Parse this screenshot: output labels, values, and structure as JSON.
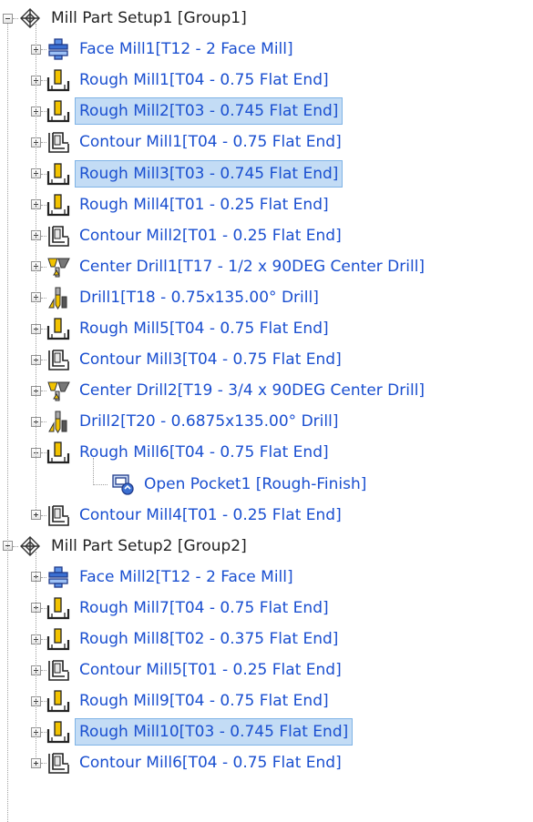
{
  "tree": {
    "groups": [
      {
        "label": "Mill Part Setup1 [Group1]",
        "icon": "mill-setup-icon",
        "expanded": true,
        "children": [
          {
            "label": "Face Mill1[T12 - 2 Face Mill]",
            "icon": "face-mill-icon",
            "selected": false
          },
          {
            "label": "Rough Mill1[T04 - 0.75 Flat End]",
            "icon": "rough-mill-icon",
            "selected": false
          },
          {
            "label": "Rough Mill2[T03 - 0.745 Flat End]",
            "icon": "rough-mill-icon",
            "selected": true
          },
          {
            "label": "Contour Mill1[T04 - 0.75 Flat End]",
            "icon": "contour-mill-icon",
            "selected": false
          },
          {
            "label": "Rough Mill3[T03 - 0.745 Flat End]",
            "icon": "rough-mill-icon",
            "selected": true
          },
          {
            "label": "Rough Mill4[T01 - 0.25 Flat End]",
            "icon": "rough-mill-icon",
            "selected": false
          },
          {
            "label": "Contour Mill2[T01 - 0.25 Flat End]",
            "icon": "contour-mill-icon",
            "selected": false
          },
          {
            "label": "Center Drill1[T17 - 1/2 x 90DEG Center Drill]",
            "icon": "center-drill-icon",
            "selected": false
          },
          {
            "label": "Drill1[T18 - 0.75x135.00° Drill]",
            "icon": "drill-icon",
            "selected": false
          },
          {
            "label": "Rough Mill5[T04 - 0.75 Flat End]",
            "icon": "rough-mill-icon",
            "selected": false
          },
          {
            "label": "Contour Mill3[T04 - 0.75 Flat End]",
            "icon": "contour-mill-icon",
            "selected": false
          },
          {
            "label": "Center Drill2[T19 - 3/4 x 90DEG Center Drill]",
            "icon": "center-drill-icon",
            "selected": false
          },
          {
            "label": "Drill2[T20 - 0.6875x135.00° Drill]",
            "icon": "drill-icon",
            "selected": false
          },
          {
            "label": "Rough Mill6[T04 - 0.75 Flat End]",
            "icon": "rough-mill-icon",
            "selected": false,
            "expanded": true,
            "children": [
              {
                "label": "Open Pocket1 [Rough-Finish]",
                "icon": "open-pocket-icon"
              }
            ]
          },
          {
            "label": "Contour Mill4[T01 - 0.25 Flat End]",
            "icon": "contour-mill-icon",
            "selected": false
          }
        ]
      },
      {
        "label": "Mill Part Setup2 [Group2]",
        "icon": "mill-setup-icon",
        "expanded": true,
        "children": [
          {
            "label": "Face Mill2[T12 - 2 Face Mill]",
            "icon": "face-mill-icon",
            "selected": false
          },
          {
            "label": "Rough Mill7[T04 - 0.75 Flat End]",
            "icon": "rough-mill-icon",
            "selected": false
          },
          {
            "label": "Rough Mill8[T02 - 0.375 Flat End]",
            "icon": "rough-mill-icon",
            "selected": false
          },
          {
            "label": "Contour Mill5[T01 - 0.25 Flat End]",
            "icon": "contour-mill-icon",
            "selected": false
          },
          {
            "label": "Rough Mill9[T04 - 0.75 Flat End]",
            "icon": "rough-mill-icon",
            "selected": false
          },
          {
            "label": "Rough Mill10[T03 - 0.745 Flat End]",
            "icon": "rough-mill-icon",
            "selected": true
          },
          {
            "label": "Contour Mill6[T04 - 0.75 Flat End]",
            "icon": "contour-mill-icon",
            "selected": false
          }
        ]
      }
    ]
  },
  "colors": {
    "operation_text": "#1a4fd0",
    "group_text": "#222222",
    "selection_bg": "#c3dcf5",
    "selection_border": "#7fb3e6"
  }
}
